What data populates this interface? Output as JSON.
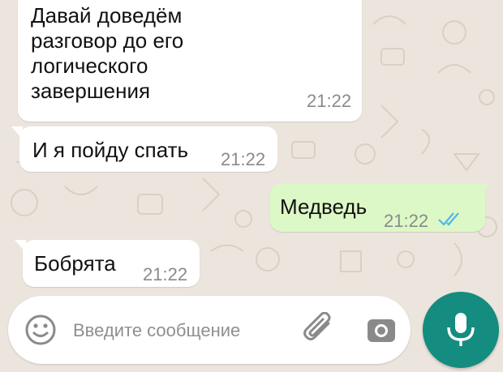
{
  "colors": {
    "wallpaper": "#ece5dd",
    "incoming_bubble": "#ffffff",
    "outgoing_bubble": "#dcf8c6",
    "read_ticks": "#4fb6ec",
    "mic_button": "#148c7f"
  },
  "messages": [
    {
      "direction": "incoming",
      "text": "Давай доведём\nразговор до его\nлогического\nзавершения",
      "time": "21:22"
    },
    {
      "direction": "incoming",
      "text": "И я пойду спать",
      "time": "21:22"
    },
    {
      "direction": "outgoing",
      "text": "Медведь",
      "time": "21:22",
      "status": "read"
    },
    {
      "direction": "incoming",
      "text": "Бобрята",
      "time": "21:22"
    }
  ],
  "composer": {
    "placeholder": "Введите сообщение",
    "icons": [
      "emoji-icon",
      "attach-icon",
      "camera-icon",
      "mic-icon"
    ]
  }
}
